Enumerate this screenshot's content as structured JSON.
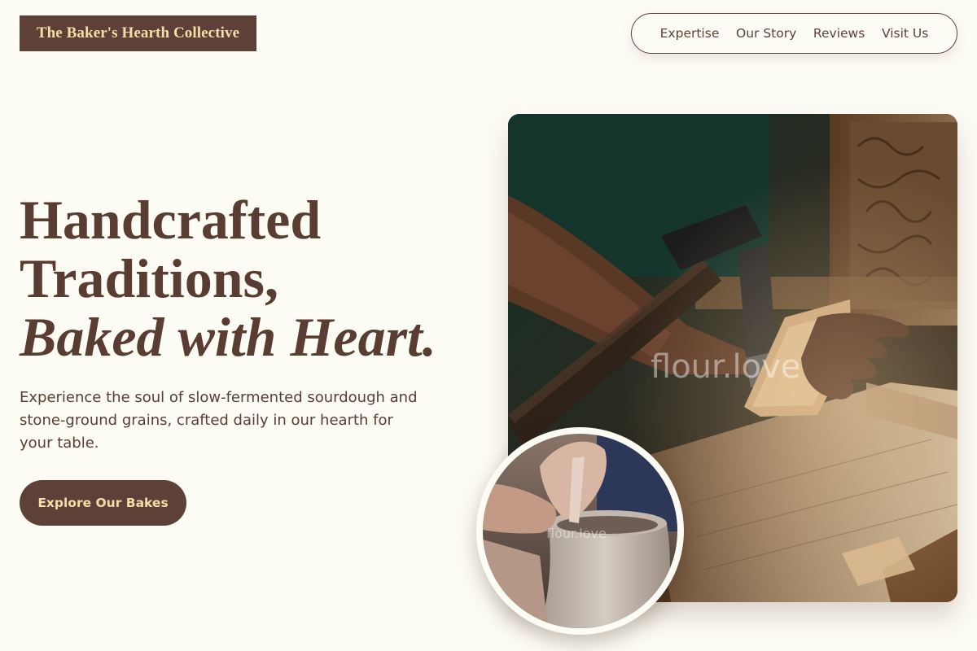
{
  "header": {
    "logo_text": "The Baker's Hearth Collective",
    "nav": [
      "Expertise",
      "Our Story",
      "Reviews",
      "Visit Us"
    ]
  },
  "hero": {
    "headline_line1": "Handcrafted",
    "headline_line2": "Traditions,",
    "headline_line3": "Baked with Heart.",
    "subtext": "Experience the soul of slow-fermented sourdough and stone-ground grains, crafted daily in our hearth for your table.",
    "cta_label": "Explore Our Bakes"
  },
  "images": {
    "main_watermark": "flour.love",
    "circle_watermark": "flour.love"
  },
  "colors": {
    "background": "#fdfcf4",
    "brand_brown": "#5d4037",
    "accent_cream": "#f3dfa5"
  }
}
